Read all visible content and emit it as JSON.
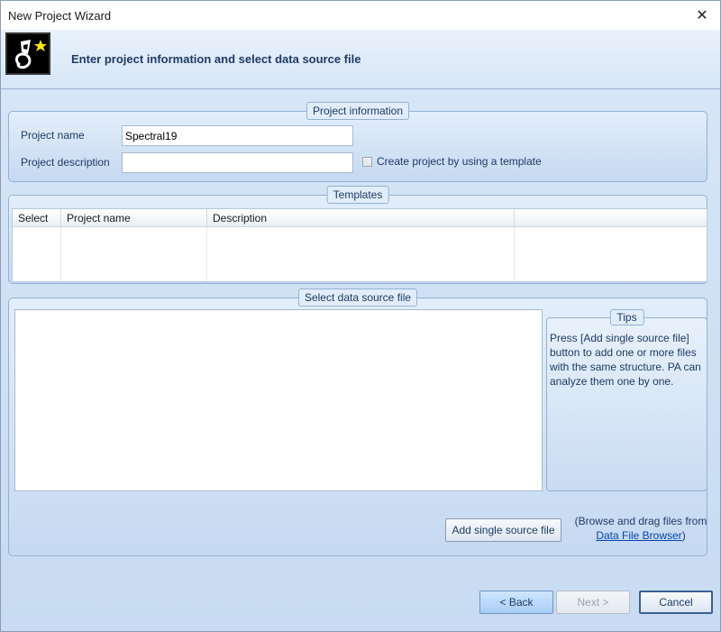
{
  "window": {
    "title": "New Project Wizard",
    "close_glyph": "✕"
  },
  "header": {
    "title": "Enter project information and select data source file",
    "logo_icon": "wizard-hat-icon"
  },
  "project_info": {
    "legend": "Project information",
    "name_label": "Project name",
    "name_value": "Spectral19",
    "description_label": "Project description",
    "description_value": "",
    "template_checkbox_label": "Create project by using a template",
    "template_checked": false
  },
  "templates": {
    "legend": "Templates",
    "columns": [
      "Select",
      "Project name",
      "Description",
      ""
    ],
    "rows": []
  },
  "data_source": {
    "legend": "Select data source file",
    "files": [],
    "tips_legend": "Tips",
    "tips_text": "Press [Add single source file] button to add one or more files with the same structure. PA can analyze them one by one.",
    "add_button": "Add single source file",
    "browse_prefix": "(Browse and drag files from ",
    "browse_link": "Data File Browser",
    "browse_suffix": ")"
  },
  "footer": {
    "back_label": "< Back",
    "next_label": "Next >",
    "cancel_label": "Cancel"
  },
  "colors": {
    "accent": "#1f3a66",
    "panel": "#cfe0f5",
    "link": "#0645ad"
  }
}
